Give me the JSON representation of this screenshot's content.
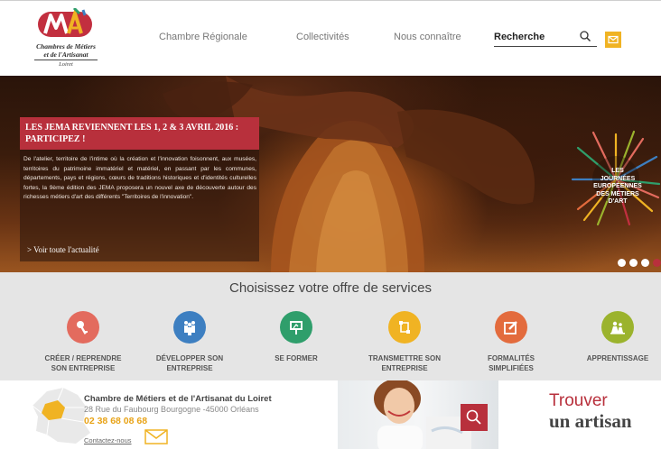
{
  "brand": {
    "logo_letters": "CMA",
    "line1": "Chambres de Métiers",
    "line2": "et de l'Artisanat",
    "department": "Loiret"
  },
  "nav": {
    "items": [
      {
        "label": "Chambre Régionale"
      },
      {
        "label": "Collectivités"
      },
      {
        "label": "Nous connaître"
      }
    ],
    "search_placeholder": "Recherche"
  },
  "hero": {
    "news_title": "Les JEMA reviennent les 1, 2 & 3 avril 2016 : participez !",
    "news_body": "De l'atelier, territoire de l'intime où la création et l'innovation foisonnent, aux musées, territoires du patrimoine immatériel et matériel, en passant par les communes, départements, pays et régions, cœurs de traditions historiques et d'identités culturelles fortes, la 9ème édition des JEMA proposera un nouvel axe de découverte autour des richesses métiers d'art des différents \"Territoires de l'innovation\".",
    "news_link": "> Voir toute l'actualité",
    "badge_lines": [
      "LES",
      "JOURNÉES",
      "EUROPÉENNES",
      "DES MÉTIERS",
      "D'ART"
    ],
    "slides_total": 4,
    "active_slide": 1
  },
  "services": {
    "title": "Choisissez votre offre de services",
    "items": [
      {
        "line1": "Créer / Reprendre",
        "line2": "son entreprise",
        "icon": "key-icon",
        "color": "#e36b5e"
      },
      {
        "line1": "Développer son",
        "line2": "entreprise",
        "icon": "people-icon",
        "color": "#3d7fc1"
      },
      {
        "line1": "Se former",
        "line2": "",
        "icon": "board-icon",
        "color": "#2f9e6b"
      },
      {
        "line1": "Transmettre son",
        "line2": "entreprise",
        "icon": "transfer-icon",
        "color": "#f0b323"
      },
      {
        "line1": "Formalités",
        "line2": "simplifiées",
        "icon": "edit-icon",
        "color": "#e36b3d"
      },
      {
        "line1": "Apprentissage",
        "line2": "",
        "icon": "apprentice-icon",
        "color": "#9bb32d"
      }
    ]
  },
  "footer": {
    "name": "Chambre de Métiers et de l'Artisanat du Loiret",
    "address": "28 Rue du Faubourg Bourgogne -45000 Orléans",
    "phone": "02 38 68 08 68",
    "contact": "Contactez-nous",
    "find_line1": "Trouver",
    "find_line2": "un artisan"
  },
  "colors": {
    "accent_red": "#b8303c",
    "accent_yellow": "#f0b323",
    "grey_band": "#e5e5e5"
  }
}
